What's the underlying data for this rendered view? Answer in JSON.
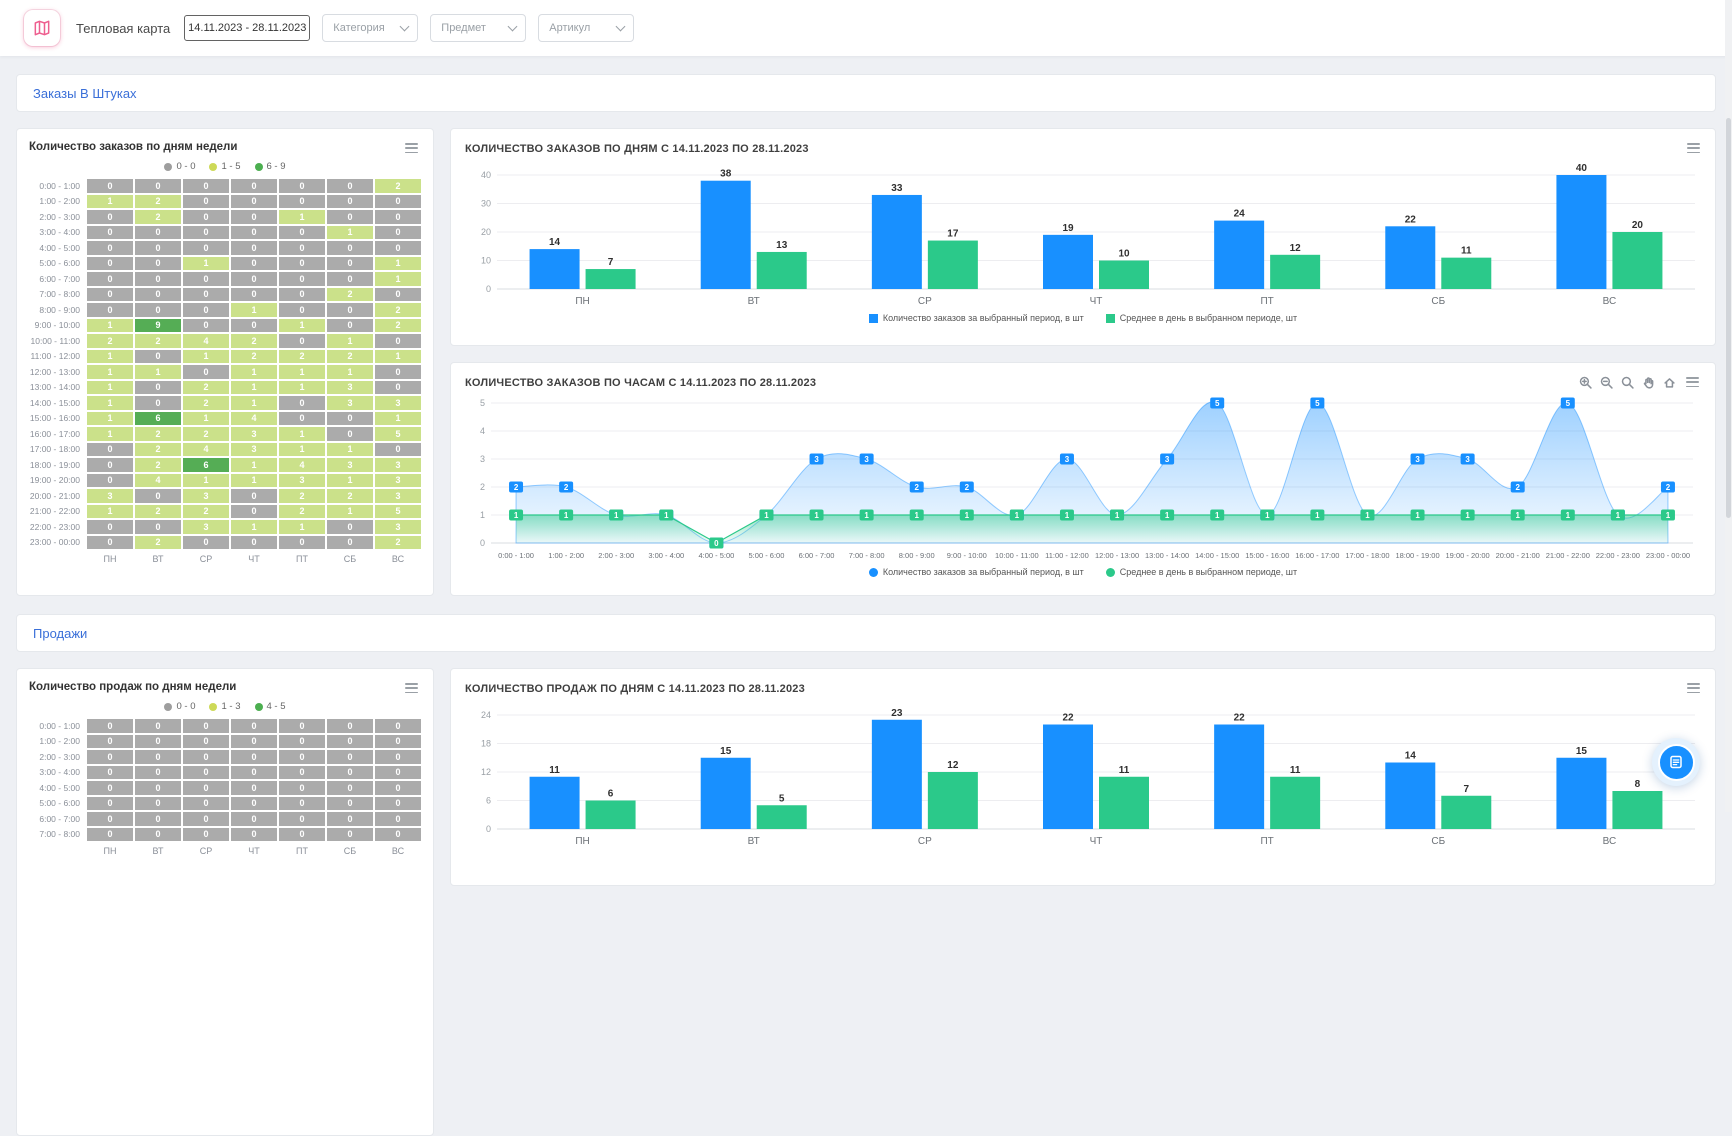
{
  "header": {
    "title": "Тепловая карта",
    "date_range": "14.11.2023 - 28.11.2023",
    "filters": [
      "Категория",
      "Предмет",
      "Артикул"
    ]
  },
  "sections": {
    "orders": {
      "title": "Заказы В Штуках"
    },
    "sales": {
      "title": "Продажи"
    }
  },
  "colors": {
    "accent_blue": "#1890ff",
    "accent_green": "#2bc98a",
    "section_link": "#3a6fd8",
    "logo_pink": "#ee5f8f"
  },
  "chart_data": [
    {
      "id": "orders_by_weekday_heatmap",
      "type": "heatmap",
      "title": "Количество заказов по дням недели",
      "legend": [
        {
          "label": "0 - 0",
          "color": "#9e9e9e"
        },
        {
          "label": "1 - 5",
          "color": "#cdd958"
        },
        {
          "label": "6 - 9",
          "color": "#4caf50"
        }
      ],
      "thresholds": [
        0,
        5
      ],
      "cell_colors": [
        "#ababab",
        "#cbe18a",
        "#55ad55"
      ],
      "columns": [
        "ПН",
        "ВТ",
        "СР",
        "ЧТ",
        "ПТ",
        "СБ",
        "ВС"
      ],
      "row_labels": [
        "0:00 - 1:00",
        "1:00 - 2:00",
        "2:00 - 3:00",
        "3:00 - 4:00",
        "4:00 - 5:00",
        "5:00 - 6:00",
        "6:00 - 7:00",
        "7:00 - 8:00",
        "8:00 - 9:00",
        "9:00 - 10:00",
        "10:00 - 11:00",
        "11:00 - 12:00",
        "12:00 - 13:00",
        "13:00 - 14:00",
        "14:00 - 15:00",
        "15:00 - 16:00",
        "16:00 - 17:00",
        "17:00 - 18:00",
        "18:00 - 19:00",
        "19:00 - 20:00",
        "20:00 - 21:00",
        "21:00 - 22:00",
        "22:00 - 23:00",
        "23:00 - 00:00"
      ],
      "values": [
        [
          0,
          0,
          0,
          0,
          0,
          0,
          2
        ],
        [
          1,
          2,
          0,
          0,
          0,
          0,
          0
        ],
        [
          0,
          2,
          0,
          0,
          1,
          0,
          0
        ],
        [
          0,
          0,
          0,
          0,
          0,
          1,
          0
        ],
        [
          0,
          0,
          0,
          0,
          0,
          0,
          0
        ],
        [
          0,
          0,
          1,
          0,
          0,
          0,
          1
        ],
        [
          0,
          0,
          0,
          0,
          0,
          0,
          1
        ],
        [
          0,
          0,
          0,
          0,
          0,
          2,
          0
        ],
        [
          0,
          0,
          0,
          1,
          0,
          0,
          2
        ],
        [
          1,
          9,
          0,
          0,
          1,
          0,
          2
        ],
        [
          2,
          2,
          4,
          2,
          0,
          1,
          0
        ],
        [
          1,
          0,
          1,
          2,
          2,
          2,
          1
        ],
        [
          1,
          1,
          0,
          1,
          1,
          1,
          0
        ],
        [
          1,
          0,
          2,
          1,
          1,
          3,
          0
        ],
        [
          1,
          0,
          2,
          1,
          0,
          3,
          3
        ],
        [
          1,
          6,
          1,
          4,
          0,
          0,
          1
        ],
        [
          1,
          2,
          2,
          3,
          1,
          0,
          5
        ],
        [
          0,
          2,
          4,
          3,
          1,
          1,
          0
        ],
        [
          0,
          2,
          6,
          1,
          4,
          3,
          3
        ],
        [
          0,
          4,
          1,
          1,
          3,
          1,
          3
        ],
        [
          3,
          0,
          3,
          0,
          2,
          2,
          3
        ],
        [
          1,
          2,
          2,
          0,
          2,
          1,
          5
        ],
        [
          0,
          0,
          3,
          1,
          1,
          0,
          3
        ],
        [
          0,
          2,
          0,
          0,
          0,
          0,
          2
        ]
      ]
    },
    {
      "id": "orders_by_day",
      "type": "bar",
      "title": "КОЛИЧЕСТВО ЗАКАЗОВ ПО ДНЯМ С 14.11.2023 ПО 28.11.2023",
      "categories": [
        "ПН",
        "ВТ",
        "СР",
        "ЧТ",
        "ПТ",
        "СБ",
        "ВС"
      ],
      "series": [
        {
          "name": "Количество заказов за выбранный период, в шт",
          "color": "#1890ff",
          "values": [
            14,
            38,
            33,
            19,
            24,
            22,
            40
          ]
        },
        {
          "name": "Среднее в день в выбранном периоде, шт",
          "color": "#2bc98a",
          "values": [
            7,
            13,
            17,
            10,
            12,
            11,
            20
          ]
        }
      ],
      "ylim": [
        0,
        40
      ],
      "yticks": [
        0,
        10,
        20,
        30,
        40
      ],
      "grid": true,
      "legend_position": "bottom"
    },
    {
      "id": "orders_by_hour",
      "type": "area",
      "title": "КОЛИЧЕСТВО ЗАКАЗОВ ПО ЧАСАМ С 14.11.2023 ПО 28.11.2023",
      "categories": [
        "0:00 - 1:00",
        "1:00 - 2:00",
        "2:00 - 3:00",
        "3:00 - 4:00",
        "4:00 - 5:00",
        "5:00 - 6:00",
        "6:00 - 7:00",
        "7:00 - 8:00",
        "8:00 - 9:00",
        "9:00 - 10:00",
        "10:00 - 11:00",
        "11:00 - 12:00",
        "12:00 - 13:00",
        "13:00 - 14:00",
        "14:00 - 15:00",
        "15:00 - 16:00",
        "16:00 - 17:00",
        "17:00 - 18:00",
        "18:00 - 19:00",
        "19:00 - 20:00",
        "20:00 - 21:00",
        "21:00 - 22:00",
        "22:00 - 23:00",
        "23:00 - 00:00"
      ],
      "series": [
        {
          "name": "Количество заказов за выбранный период, в шт",
          "color": "#1890ff",
          "values": [
            2,
            2,
            1,
            1,
            0,
            1,
            3,
            3,
            2,
            2,
            1,
            3,
            1,
            3,
            5,
            1,
            5,
            1,
            3,
            3,
            2,
            5,
            1,
            2
          ]
        },
        {
          "name": "Среднее в день в выбранном периоде, шт",
          "color": "#2bc98a",
          "values": [
            1,
            1,
            1,
            1,
            0,
            1,
            1,
            1,
            1,
            1,
            1,
            1,
            1,
            1,
            1,
            1,
            1,
            1,
            1,
            1,
            1,
            1,
            1,
            1
          ]
        }
      ],
      "ylim": [
        0,
        5
      ],
      "yticks": [
        0,
        1,
        2,
        3,
        4,
        5
      ],
      "grid": true,
      "legend_position": "bottom",
      "toolbar": [
        "zoom-in",
        "zoom-out",
        "search",
        "pan",
        "home",
        "menu"
      ]
    },
    {
      "id": "sales_by_weekday_heatmap",
      "type": "heatmap",
      "title": "Количество продаж по дням недели",
      "legend": [
        {
          "label": "0 - 0",
          "color": "#9e9e9e"
        },
        {
          "label": "1 - 3",
          "color": "#cdd958"
        },
        {
          "label": "4 - 5",
          "color": "#4caf50"
        }
      ],
      "thresholds": [
        0,
        3
      ],
      "cell_colors": [
        "#ababab",
        "#cbe18a",
        "#55ad55"
      ],
      "columns": [
        "ПН",
        "ВТ",
        "СР",
        "ЧТ",
        "ПТ",
        "СБ",
        "ВС"
      ],
      "row_labels": [
        "0:00 - 1:00",
        "1:00 - 2:00",
        "2:00 - 3:00",
        "3:00 - 4:00",
        "4:00 - 5:00",
        "5:00 - 6:00",
        "6:00 - 7:00",
        "7:00 - 8:00"
      ],
      "values": [
        [
          0,
          0,
          0,
          0,
          0,
          0,
          0
        ],
        [
          0,
          0,
          0,
          0,
          0,
          0,
          0
        ],
        [
          0,
          0,
          0,
          0,
          0,
          0,
          0
        ],
        [
          0,
          0,
          0,
          0,
          0,
          0,
          0
        ],
        [
          0,
          0,
          0,
          0,
          0,
          0,
          0
        ],
        [
          0,
          0,
          0,
          0,
          0,
          0,
          0
        ],
        [
          0,
          0,
          0,
          0,
          0,
          0,
          0
        ],
        [
          0,
          0,
          0,
          0,
          0,
          0,
          0
        ]
      ]
    },
    {
      "id": "sales_by_day",
      "type": "bar",
      "title": "КОЛИЧЕСТВО ПРОДАЖ ПО ДНЯМ С 14.11.2023 ПО 28.11.2023",
      "categories": [
        "ПН",
        "ВТ",
        "СР",
        "ЧТ",
        "ПТ",
        "СБ",
        "ВС"
      ],
      "series": [
        {
          "color": "#1890ff",
          "values": [
            11,
            15,
            23,
            22,
            22,
            14,
            15
          ]
        },
        {
          "color": "#2bc98a",
          "values": [
            6,
            5,
            12,
            11,
            11,
            7,
            8
          ]
        }
      ],
      "ylim": [
        0,
        24
      ],
      "yticks": [
        0,
        6,
        12,
        18,
        24
      ],
      "grid": true
    }
  ]
}
